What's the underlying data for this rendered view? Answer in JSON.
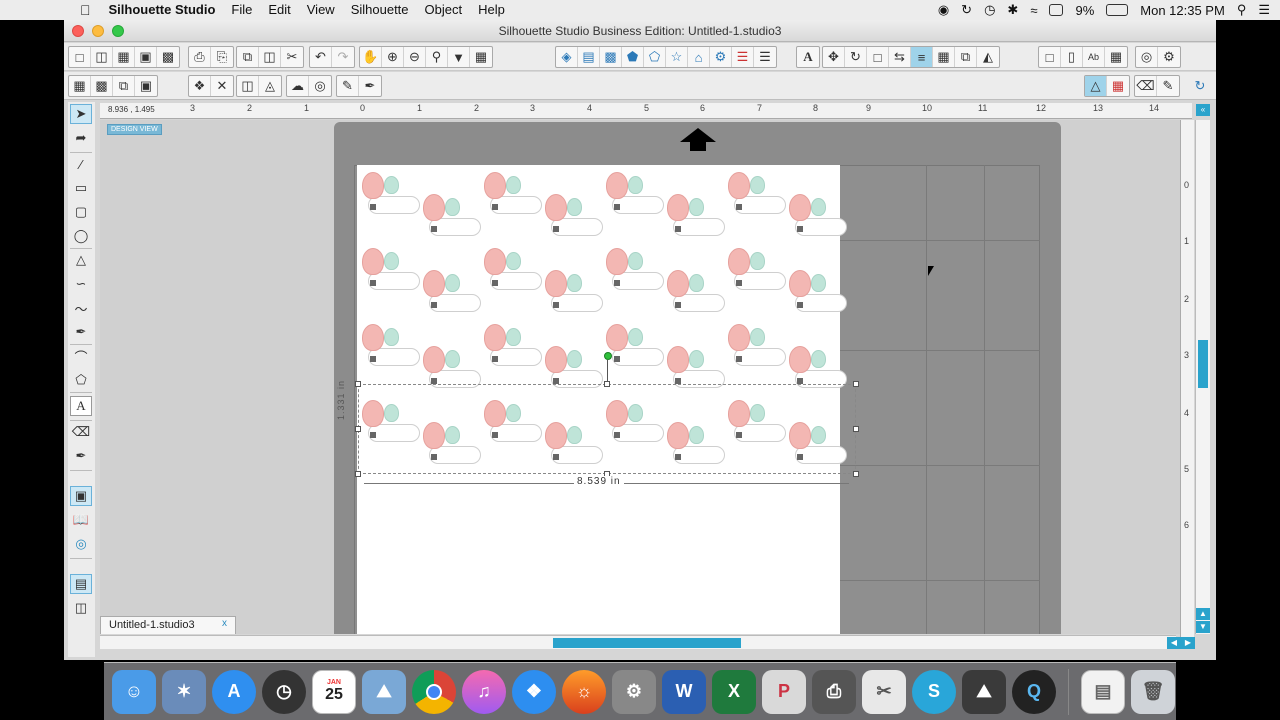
{
  "menubar": {
    "app_name": "Silhouette Studio",
    "items": [
      "File",
      "Edit",
      "View",
      "Silhouette",
      "Object",
      "Help"
    ],
    "battery": "9%",
    "clock": "Mon 12:35 PM"
  },
  "window": {
    "title": "Silhouette Studio Business Edition: Untitled-1.studio3"
  },
  "rulers": {
    "coords": "8.936 , 1.495",
    "top_numbers": [
      "3",
      "2",
      "1",
      "0",
      "1",
      "2",
      "3",
      "4",
      "5",
      "6",
      "7",
      "8",
      "9",
      "10",
      "11",
      "12",
      "13",
      "14"
    ],
    "left_numbers": [
      "0",
      "1",
      "2",
      "3",
      "4",
      "5",
      "6"
    ]
  },
  "canvas": {
    "design_view_label": "DESIGN VIEW",
    "width_label": "8.539 in",
    "height_label": "1.331 in"
  },
  "tabs": {
    "document": "Untitled-1.studio3",
    "close": "x"
  },
  "colors": {
    "accent": "#2aa3cc",
    "balloon_pink": "#f3b7b3",
    "balloon_mint": "#bfe4d8",
    "mat": "#8c8c8c"
  },
  "dock": {
    "calendar_day": "25",
    "calendar_month": "JAN",
    "icons": [
      "finder-icon",
      "preview-icon",
      "app-store-icon",
      "dashboard-icon",
      "calendar-icon",
      "photos-icon",
      "chrome-icon",
      "itunes-icon",
      "safari-icon",
      "firefox-icon",
      "system-preferences-icon",
      "word-icon",
      "excel-icon",
      "powerpoint-icon",
      "printer-icon",
      "scissors-icon",
      "silhouette-icon",
      "photo-booth-icon",
      "quicktime-icon",
      "document-icon",
      "trash-icon"
    ]
  }
}
